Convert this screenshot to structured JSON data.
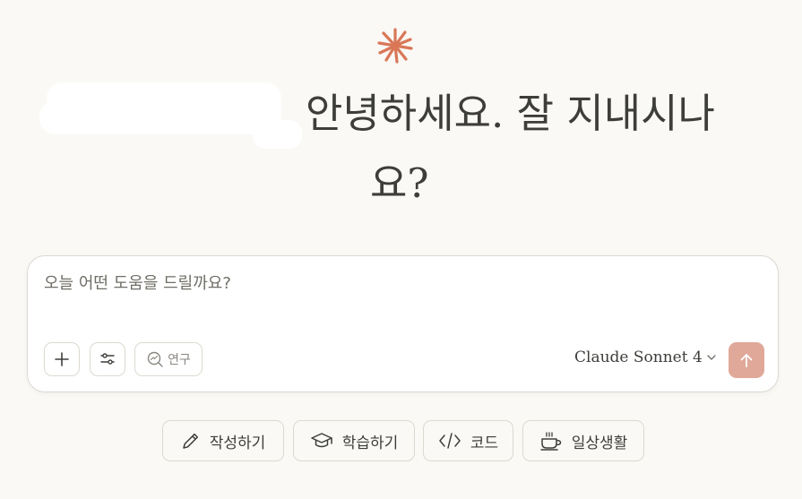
{
  "greeting": {
    "line1": "안녕하세요. 잘 지내시나",
    "line2": "요?"
  },
  "composer": {
    "placeholder": "오늘 어떤 도움을 드릴까요?",
    "value": "",
    "research_label": "연구",
    "model_label": "Claude Sonnet 4"
  },
  "suggestions": [
    {
      "label": "작성하기",
      "icon": "pencil-icon"
    },
    {
      "label": "학습하기",
      "icon": "graduation-cap-icon"
    },
    {
      "label": "코드",
      "icon": "code-icon"
    },
    {
      "label": "일상생활",
      "icon": "coffee-cup-icon"
    }
  ],
  "colors": {
    "background": "#faf9f5",
    "accent": "#d97757",
    "send_button": "#e0a899",
    "text": "#3d3d3a"
  }
}
